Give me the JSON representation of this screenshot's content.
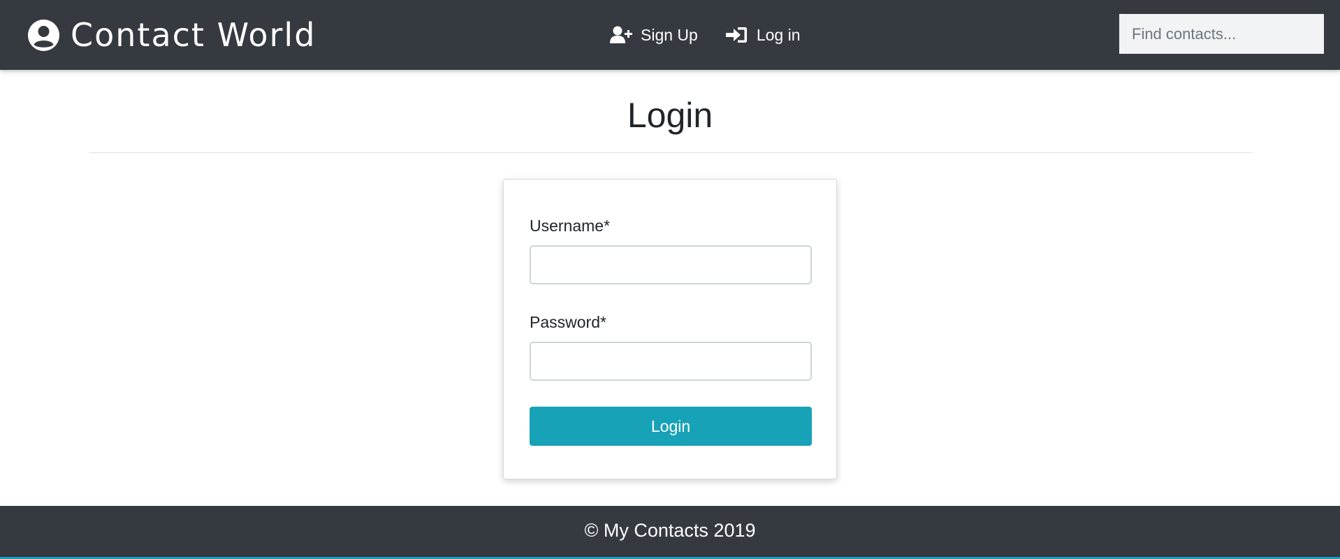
{
  "navbar": {
    "brand": "Contact World",
    "brand_icon": "user-circle-icon",
    "links": [
      {
        "label": "Sign Up",
        "icon": "user-plus-icon"
      },
      {
        "label": "Log in",
        "icon": "sign-in-icon"
      }
    ],
    "search": {
      "placeholder": "Find contacts...",
      "value": ""
    }
  },
  "main": {
    "title": "Login",
    "form": {
      "username_label": "Username*",
      "username_value": "",
      "password_label": "Password*",
      "password_value": "",
      "submit_label": "Login"
    }
  },
  "footer": {
    "text": "© My Contacts 2019"
  },
  "colors": {
    "navbar": "#343a40",
    "accent": "#17a2b8",
    "text": "#212529"
  }
}
